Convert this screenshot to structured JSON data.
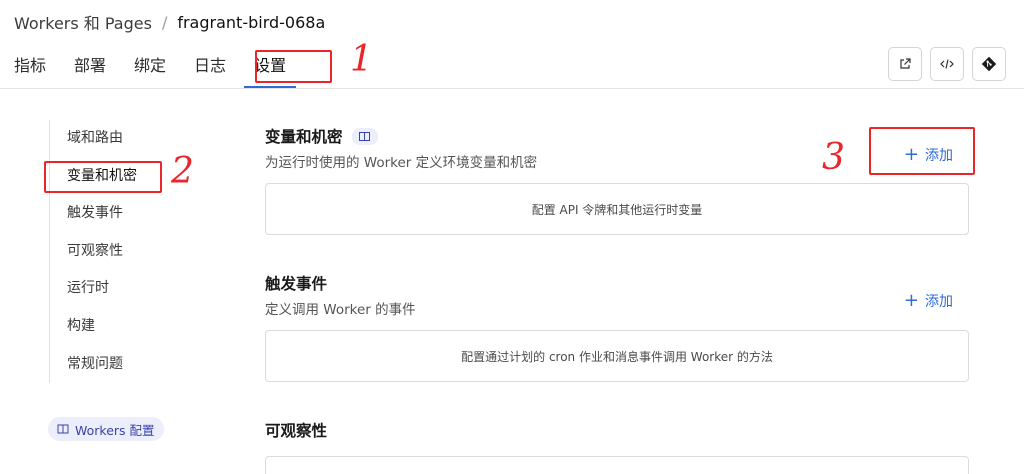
{
  "breadcrumb": {
    "root": "Workers 和 Pages",
    "separator": "/",
    "current": "fragrant-bird-068a"
  },
  "tabs": [
    {
      "label": "指标"
    },
    {
      "label": "部署"
    },
    {
      "label": "绑定"
    },
    {
      "label": "日志"
    },
    {
      "label": "设置",
      "active": true
    }
  ],
  "toolbar": {
    "icons": [
      "external-link-icon",
      "code-icon",
      "git-icon"
    ]
  },
  "sidebar": {
    "items": [
      {
        "label": "域和路由"
      },
      {
        "label": "变量和机密",
        "active": true
      },
      {
        "label": "触发事件"
      },
      {
        "label": "可观察性"
      },
      {
        "label": "运行时"
      },
      {
        "label": "构建"
      },
      {
        "label": "常规问题"
      }
    ],
    "config_link": "Workers 配置"
  },
  "sections": {
    "variables": {
      "title": "变量和机密",
      "description": "为运行时使用的 Worker 定义环境变量和机密",
      "add_label": "添加",
      "empty_text": "配置 API 令牌和其他运行时变量"
    },
    "triggers": {
      "title": "触发事件",
      "description": "定义调用 Worker 的事件",
      "add_label": "添加",
      "empty_text": "配置通过计划的 cron 作业和消息事件调用 Worker 的方法"
    },
    "observability": {
      "title": "可观察性"
    }
  },
  "annotations": {
    "marker_1": "1",
    "marker_2": "2",
    "marker_3": "3"
  },
  "colors": {
    "accent": "#2f6bd8",
    "annotation": "#e8262b",
    "badge_bg": "#eceefb"
  }
}
